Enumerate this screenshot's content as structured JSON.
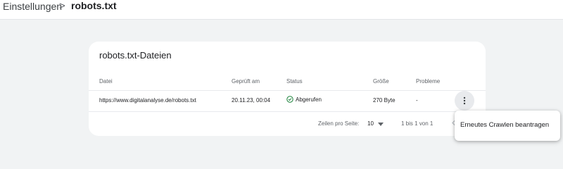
{
  "breadcrumb": {
    "root": "Einstellungen",
    "separator": ">",
    "current": "robots.txt"
  },
  "card": {
    "title": "robots.txt-Dateien",
    "columns": {
      "file": "Datei",
      "checked": "Geprüft am",
      "status": "Status",
      "size": "Größe",
      "problems": "Probleme"
    },
    "rows": [
      {
        "file": "https://www.digitalanalyse.de/robots.txt",
        "checked": "20.11.23, 00:04",
        "status": "Abgerufen",
        "size": "270 Byte",
        "problems": "-"
      }
    ],
    "pagination": {
      "rows_per_page_label": "Zeilen pro Seite:",
      "rows_per_page_value": "10",
      "range": "1 bis 1 von 1"
    }
  },
  "menu": {
    "items": [
      "Erneutes Crawlen beantragen"
    ]
  },
  "icons": {
    "status": "check-circle-icon",
    "more": "more-vert-icon",
    "dropdown": "caret-down-icon",
    "prev": "chevron-left-icon"
  },
  "colors": {
    "status_ok": "#188038",
    "background": "#f1f3f4"
  }
}
